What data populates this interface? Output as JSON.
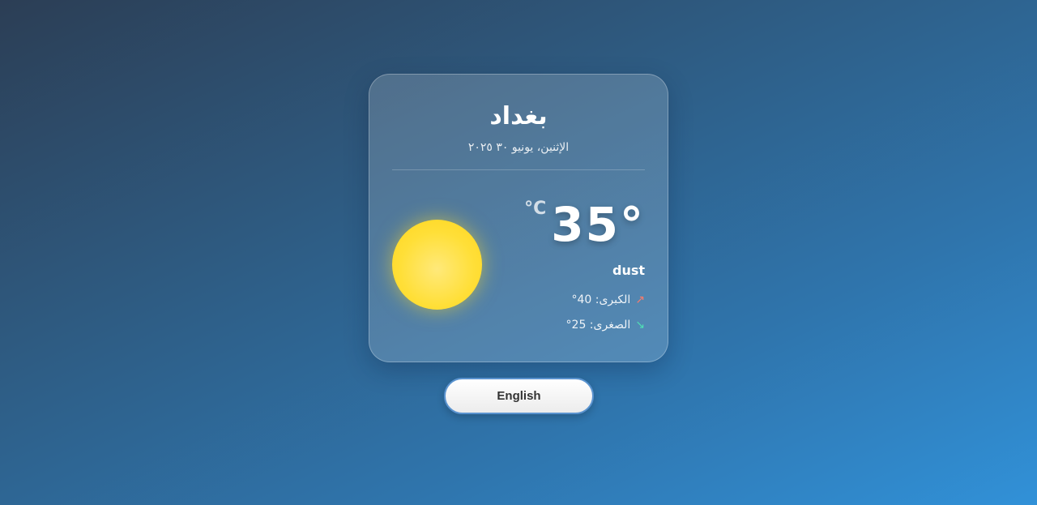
{
  "weather": {
    "city": "بغداد",
    "date": "الإثنين، يونيو ٣٠ ٢٠٢٥",
    "temperature": "35°",
    "unit": "°C",
    "description": "dust",
    "high_label": "الكبرى: 40°",
    "low_label": "الصغرى: 25°",
    "high_arrow": "↗",
    "low_arrow": "↘",
    "icon": "sun-icon"
  },
  "language_toggle": {
    "label": "English"
  },
  "colors": {
    "background_start": "#2c3e55",
    "background_end": "#3191d8",
    "sun": "#ffdf38",
    "high_arrow": "#ff7b6b",
    "low_arrow": "#4fe0b5"
  }
}
